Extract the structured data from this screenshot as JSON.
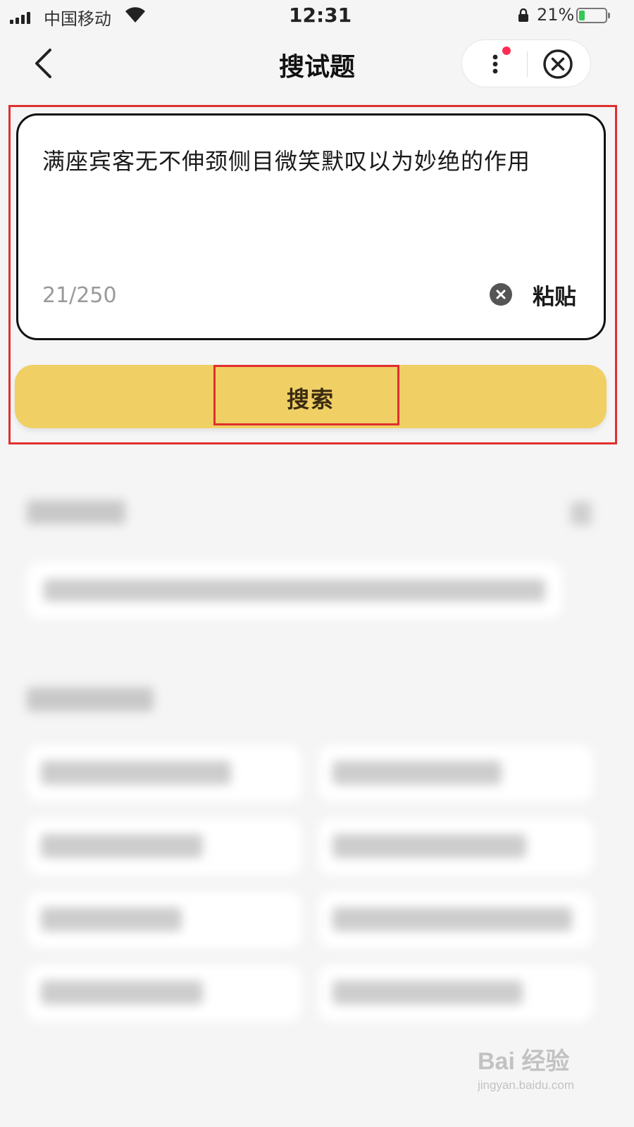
{
  "status_bar": {
    "carrier": "中国移动",
    "time": "12:31",
    "battery_percent": "21%",
    "battery_level": 0.21
  },
  "nav": {
    "title": "搜试题"
  },
  "search_box": {
    "query": "满座宾客无不伸颈侧目微笑默叹以为妙绝的作用",
    "counter": "21/250",
    "paste_label": "粘贴"
  },
  "search_button": {
    "label": "搜索"
  },
  "colors": {
    "accent": "#f0d064",
    "highlight": "#e02f2f",
    "badge": "#ff2d55"
  },
  "watermark": {
    "text": "Bai 经验",
    "url": "jingyan.baidu.com"
  }
}
